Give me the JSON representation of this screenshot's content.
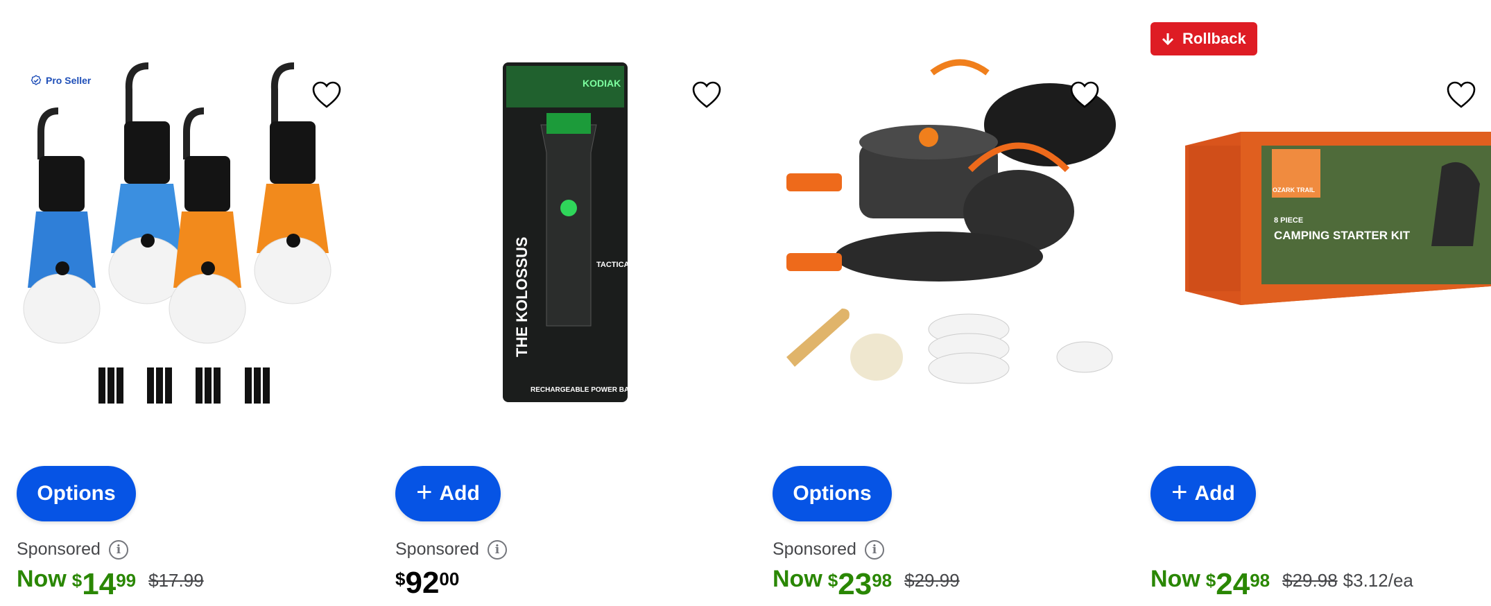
{
  "products": [
    {
      "badge": "",
      "seller_tag": "Pro Seller",
      "button_label": "Options",
      "button_type": "options",
      "sponsored": "Sponsored",
      "price": {
        "prefix": "Now",
        "currency": "$",
        "dollars": "14",
        "cents": "99",
        "was": "$17.99",
        "unit": ""
      },
      "image_icon": "camping-lantern-bulbs"
    },
    {
      "badge": "",
      "seller_tag": "",
      "button_label": "Add",
      "button_type": "add",
      "sponsored": "Sponsored",
      "price": {
        "prefix": "",
        "currency": "$",
        "dollars": "92",
        "cents": "00",
        "was": "",
        "unit": ""
      },
      "image_icon": "tactical-flashlight-package",
      "package_text": {
        "brand": "KODIAK",
        "title": "THE KOLOSSUS",
        "grade": "TACTICAL GRADE",
        "footer": "RECHARGEABLE POWER BANK"
      }
    },
    {
      "badge": "",
      "seller_tag": "",
      "button_label": "Options",
      "button_type": "options",
      "sponsored": "Sponsored",
      "price": {
        "prefix": "Now",
        "currency": "$",
        "dollars": "23",
        "cents": "98",
        "was": "$29.99",
        "unit": ""
      },
      "image_icon": "camping-cookware-set"
    },
    {
      "badge": "Rollback",
      "seller_tag": "",
      "button_label": "Add",
      "button_type": "add",
      "sponsored": "",
      "price": {
        "prefix": "Now",
        "currency": "$",
        "dollars": "24",
        "cents": "98",
        "was": "$29.98",
        "unit": "$3.12/ea"
      },
      "image_icon": "camping-starter-kit-box",
      "package_text": {
        "brand": "OZARK TRAIL",
        "pieces": "8 PIECE",
        "title": "CAMPING STARTER KIT"
      }
    }
  ],
  "colors": {
    "action_blue": "#0654e5",
    "price_green": "#2a8703",
    "rollback_red": "#de1c24"
  }
}
